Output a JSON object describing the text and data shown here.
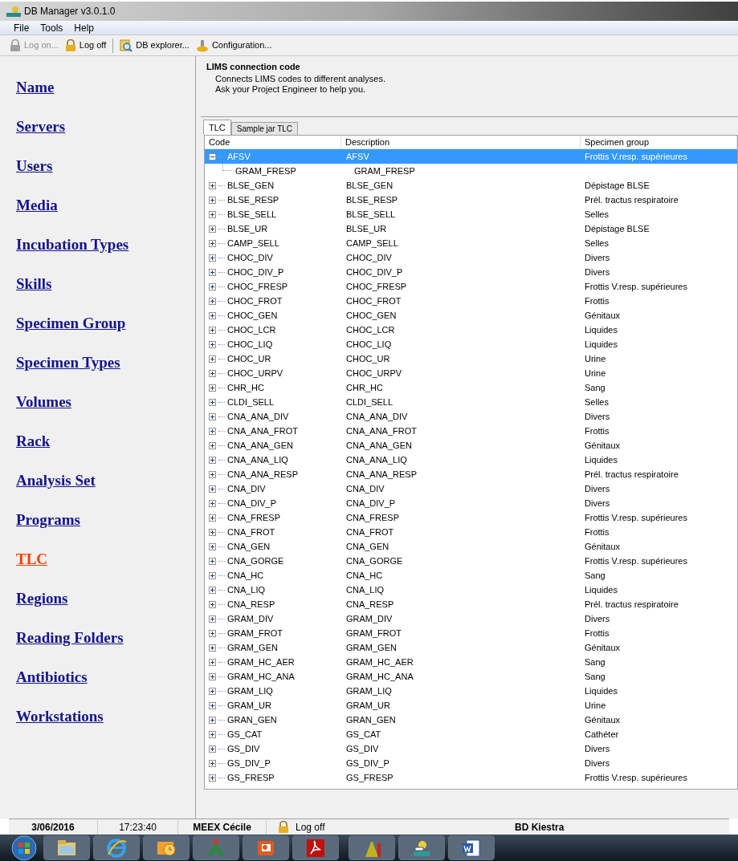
{
  "window": {
    "title": "DB Manager v3.0.1.0"
  },
  "menu": [
    "File",
    "Tools",
    "Help"
  ],
  "toolbar": [
    {
      "label": "Log on...",
      "disabled": true,
      "kind": "lock"
    },
    {
      "label": "Log off",
      "disabled": false,
      "kind": "lock"
    },
    {
      "label": "DB explorer...",
      "disabled": false,
      "kind": "explorer"
    },
    {
      "label": "Configuration...",
      "disabled": false,
      "kind": "config"
    }
  ],
  "sidebar": {
    "items": [
      {
        "label": "Name",
        "selected": false
      },
      {
        "label": "Servers",
        "selected": false
      },
      {
        "label": "Users",
        "selected": false
      },
      {
        "label": "Media",
        "selected": false
      },
      {
        "label": "Incubation Types",
        "selected": false
      },
      {
        "label": "Skills",
        "selected": false
      },
      {
        "label": "Specimen Group",
        "selected": false
      },
      {
        "label": "Specimen Types",
        "selected": false
      },
      {
        "label": "Volumes",
        "selected": false
      },
      {
        "label": "Rack",
        "selected": false
      },
      {
        "label": "Analysis Set",
        "selected": false
      },
      {
        "label": "Programs",
        "selected": false
      },
      {
        "label": "TLC",
        "selected": true
      },
      {
        "label": "Regions",
        "selected": false
      },
      {
        "label": "Reading Folders",
        "selected": false
      },
      {
        "label": "Antibiotics",
        "selected": false
      },
      {
        "label": "Workstations",
        "selected": false
      }
    ]
  },
  "header": {
    "title": "LIMS connection code",
    "lines": [
      "Connects LIMS codes to different analyses.",
      "Ask your Project Engineer  to help you."
    ]
  },
  "tabs": [
    {
      "label": "TLC",
      "selected": true
    },
    {
      "label": "Sample jar TLC",
      "selected": false
    }
  ],
  "table": {
    "columns": [
      "Code",
      "Description",
      "Specimen group"
    ],
    "rows": [
      {
        "code": "AFSV",
        "description": "AFSV",
        "specimen_group": "Frottis V.resp. supérieures",
        "expanded": true,
        "selected": true,
        "children": [
          {
            "code": "GRAM_FRESP",
            "description": "GRAM_FRESP"
          }
        ]
      },
      {
        "code": "BLSE_GEN",
        "description": "BLSE_GEN",
        "specimen_group": "Dépistage BLSE",
        "expanded": false,
        "selected": false
      },
      {
        "code": "BLSE_RESP",
        "description": "BLSE_RESP",
        "specimen_group": "Prél. tractus respiratoire",
        "expanded": false,
        "selected": false
      },
      {
        "code": "BLSE_SELL",
        "description": "BLSE_SELL",
        "specimen_group": "Selles",
        "expanded": false,
        "selected": false
      },
      {
        "code": "BLSE_UR",
        "description": "BLSE_UR",
        "specimen_group": "Dépistage BLSE",
        "expanded": false,
        "selected": false
      },
      {
        "code": "CAMP_SELL",
        "description": "CAMP_SELL",
        "specimen_group": "Selles",
        "expanded": false,
        "selected": false
      },
      {
        "code": "CHOC_DIV",
        "description": "CHOC_DIV",
        "specimen_group": "Divers",
        "expanded": false,
        "selected": false
      },
      {
        "code": "CHOC_DIV_P",
        "description": "CHOC_DIV_P",
        "specimen_group": "Divers",
        "expanded": false,
        "selected": false
      },
      {
        "code": "CHOC_FRESP",
        "description": "CHOC_FRESP",
        "specimen_group": "Frottis V.resp. supérieures",
        "expanded": false,
        "selected": false
      },
      {
        "code": "CHOC_FROT",
        "description": "CHOC_FROT",
        "specimen_group": "Frottis",
        "expanded": false,
        "selected": false
      },
      {
        "code": "CHOC_GEN",
        "description": "CHOC_GEN",
        "specimen_group": "Génitaux",
        "expanded": false,
        "selected": false
      },
      {
        "code": "CHOC_LCR",
        "description": "CHOC_LCR",
        "specimen_group": "Liquides",
        "expanded": false,
        "selected": false
      },
      {
        "code": "CHOC_LIQ",
        "description": "CHOC_LIQ",
        "specimen_group": "Liquides",
        "expanded": false,
        "selected": false
      },
      {
        "code": "CHOC_UR",
        "description": "CHOC_UR",
        "specimen_group": "Urine",
        "expanded": false,
        "selected": false
      },
      {
        "code": "CHOC_URPV",
        "description": "CHOC_URPV",
        "specimen_group": "Urine",
        "expanded": false,
        "selected": false
      },
      {
        "code": "CHR_HC",
        "description": "CHR_HC",
        "specimen_group": "Sang",
        "expanded": false,
        "selected": false
      },
      {
        "code": "CLDI_SELL",
        "description": "CLDI_SELL",
        "specimen_group": "Selles",
        "expanded": false,
        "selected": false
      },
      {
        "code": "CNA_ANA_DIV",
        "description": "CNA_ANA_DIV",
        "specimen_group": "Divers",
        "expanded": false,
        "selected": false
      },
      {
        "code": "CNA_ANA_FROT",
        "description": "CNA_ANA_FROT",
        "specimen_group": "Frottis",
        "expanded": false,
        "selected": false
      },
      {
        "code": "CNA_ANA_GEN",
        "description": "CNA_ANA_GEN",
        "specimen_group": "Génitaux",
        "expanded": false,
        "selected": false
      },
      {
        "code": "CNA_ANA_LIQ",
        "description": "CNA_ANA_LIQ",
        "specimen_group": "Liquides",
        "expanded": false,
        "selected": false
      },
      {
        "code": "CNA_ANA_RESP",
        "description": "CNA_ANA_RESP",
        "specimen_group": "Prél. tractus respiratoire",
        "expanded": false,
        "selected": false
      },
      {
        "code": "CNA_DIV",
        "description": "CNA_DIV",
        "specimen_group": "Divers",
        "expanded": false,
        "selected": false
      },
      {
        "code": "CNA_DIV_P",
        "description": "CNA_DIV_P",
        "specimen_group": "Divers",
        "expanded": false,
        "selected": false
      },
      {
        "code": "CNA_FRESP",
        "description": "CNA_FRESP",
        "specimen_group": "Frottis V.resp. supérieures",
        "expanded": false,
        "selected": false
      },
      {
        "code": "CNA_FROT",
        "description": "CNA_FROT",
        "specimen_group": "Frottis",
        "expanded": false,
        "selected": false
      },
      {
        "code": "CNA_GEN",
        "description": "CNA_GEN",
        "specimen_group": "Génitaux",
        "expanded": false,
        "selected": false
      },
      {
        "code": "CNA_GORGE",
        "description": "CNA_GORGE",
        "specimen_group": "Frottis V.resp. supérieures",
        "expanded": false,
        "selected": false
      },
      {
        "code": "CNA_HC",
        "description": "CNA_HC",
        "specimen_group": "Sang",
        "expanded": false,
        "selected": false
      },
      {
        "code": "CNA_LIQ",
        "description": "CNA_LIQ",
        "specimen_group": "Liquides",
        "expanded": false,
        "selected": false
      },
      {
        "code": "CNA_RESP",
        "description": "CNA_RESP",
        "specimen_group": "Prél. tractus respiratoire",
        "expanded": false,
        "selected": false
      },
      {
        "code": "GRAM_DIV",
        "description": "GRAM_DIV",
        "specimen_group": "Divers",
        "expanded": false,
        "selected": false
      },
      {
        "code": "GRAM_FROT",
        "description": "GRAM_FROT",
        "specimen_group": "Frottis",
        "expanded": false,
        "selected": false
      },
      {
        "code": "GRAM_GEN",
        "description": "GRAM_GEN",
        "specimen_group": "Génitaux",
        "expanded": false,
        "selected": false
      },
      {
        "code": "GRAM_HC_AER",
        "description": "GRAM_HC_AER",
        "specimen_group": "Sang",
        "expanded": false,
        "selected": false
      },
      {
        "code": "GRAM_HC_ANA",
        "description": "GRAM_HC_ANA",
        "specimen_group": "Sang",
        "expanded": false,
        "selected": false
      },
      {
        "code": "GRAM_LIQ",
        "description": "GRAM_LIQ",
        "specimen_group": "Liquides",
        "expanded": false,
        "selected": false
      },
      {
        "code": "GRAM_UR",
        "description": "GRAM_UR",
        "specimen_group": "Urine",
        "expanded": false,
        "selected": false
      },
      {
        "code": "GRAN_GEN",
        "description": "GRAN_GEN",
        "specimen_group": "Génitaux",
        "expanded": false,
        "selected": false
      },
      {
        "code": "GS_CAT",
        "description": "GS_CAT",
        "specimen_group": "Cathéter",
        "expanded": false,
        "selected": false
      },
      {
        "code": "GS_DIV",
        "description": "GS_DIV",
        "specimen_group": "Divers",
        "expanded": false,
        "selected": false
      },
      {
        "code": "GS_DIV_P",
        "description": "GS_DIV_P",
        "specimen_group": "Divers",
        "expanded": false,
        "selected": false
      },
      {
        "code": "GS_FRESP",
        "description": "GS_FRESP",
        "specimen_group": "Frottis V.resp. supérieures",
        "expanded": false,
        "selected": false
      }
    ]
  },
  "status_bar": {
    "date": "3/06/2016",
    "time": "17:23:40",
    "user": "MEEX Cécile",
    "action": "Log off",
    "database": "BD Kiestra"
  },
  "taskbar": [
    {
      "kind": "folder"
    },
    {
      "kind": "browser"
    },
    {
      "kind": "mail"
    },
    {
      "kind": "app"
    },
    {
      "kind": "slides"
    },
    {
      "kind": "pdf"
    },
    {
      "kind": "chart"
    },
    {
      "kind": "dbmanager"
    },
    {
      "kind": "word"
    }
  ]
}
